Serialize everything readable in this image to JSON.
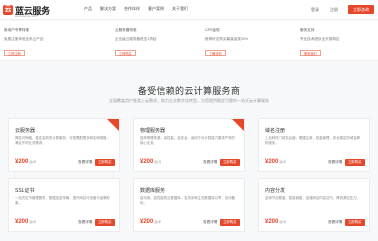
{
  "header": {
    "logo_mark": "云",
    "logo_text": "蓝云服务",
    "logo_sub": "www.lanyun.com",
    "nav": [
      "产品",
      "解决方案",
      "合作伙伴",
      "客户案例",
      "关于我们"
    ],
    "links": [
      "登录",
      "注册"
    ],
    "cta": "立即咨询"
  },
  "promos": [
    {
      "title": "新用户专享特惠",
      "desc": "免费注册体验全系云产品",
      "button": "立即注册"
    },
    {
      "title": "云服务器特惠",
      "desc": "企业级云服务器低至1折起",
      "button": "立即购买"
    },
    {
      "title": "CPS返现",
      "desc": "推荐好友购买最高返现30%",
      "button": "了解详情"
    },
    {
      "title": "服务支持",
      "desc": "专业技术团队全天候响应",
      "button": "联系我们"
    }
  ],
  "section": {
    "title": "备受信赖的云计算服务商",
    "subtitle": "全面覆盖用户各类上云需求，助力企业数字化转型，为您提供稳定可靠的一站式云计算服务"
  },
  "cards": [
    {
      "title": "云服务器",
      "desc": "弹性可伸缩，稳定高效的计算服务，可按需配置多种实例规格，满足不同业务需求。",
      "price": "¥200",
      "unit": "起/年",
      "link": "查看详情",
      "button": "立即购买",
      "badge": true
    },
    {
      "title": "物理服务器",
      "desc": "独享物理资源，高性能、高安全，适用于对计算能力要求严苛的核心业务。",
      "price": "¥200",
      "unit": "起/月",
      "link": "查看详情",
      "button": "立即购买",
      "badge": true
    },
    {
      "title": "域名注册",
      "desc": "上百种热门域名后缀，便捷注册，批量管理，安全稳定的域名解析服务。",
      "price": "¥200",
      "unit": "起/年",
      "link": "查看详情",
      "button": "立即购买",
      "badge": false
    },
    {
      "title": "SSL证书",
      "desc": "一站式证书管理服务，数据加密传输，提升网站可信度与品牌形象。",
      "price": "¥200",
      "unit": "起/年",
      "link": "查看详情",
      "button": "立即购买",
      "badge": false
    },
    {
      "title": "数据库服务",
      "desc": "高可用、高性能的云数据库，支持多种主流数据库引擎，自动备份。",
      "price": "¥200",
      "unit": "起/年",
      "link": "查看详情",
      "button": "立即购买",
      "badge": false
    },
    {
      "title": "内容分发",
      "desc": "全球节点覆盖，智能调度，加速网站内容访问，降低源站压力。",
      "price": "¥200",
      "unit": "起/年",
      "link": "查看详情",
      "button": "立即购买",
      "badge": false
    }
  ]
}
